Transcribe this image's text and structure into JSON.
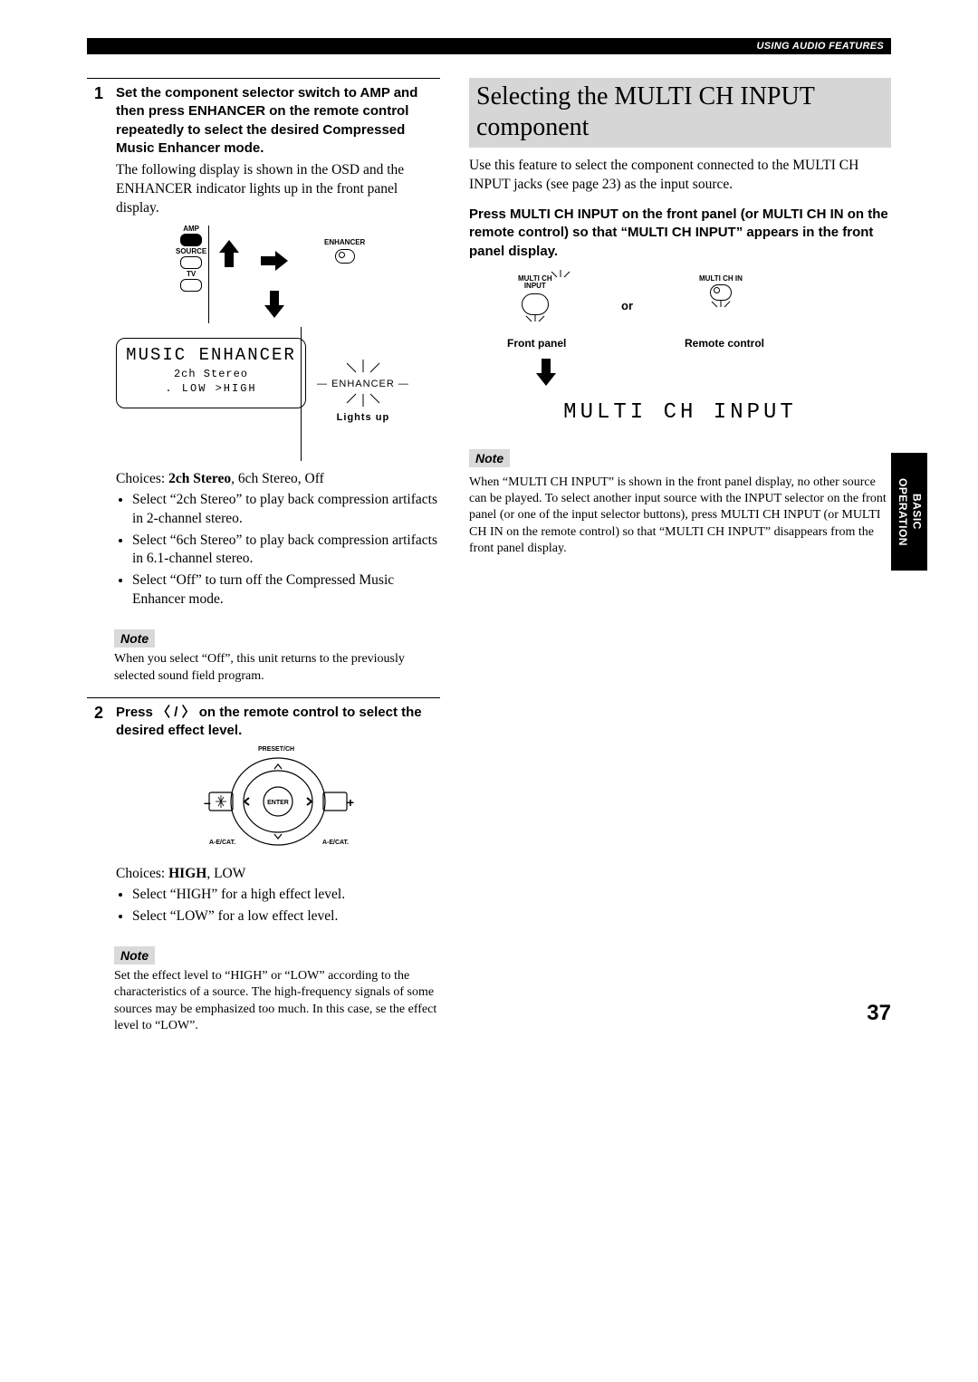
{
  "header": {
    "section": "USING AUDIO FEATURES"
  },
  "sideTab": "BASIC\nOPERATION",
  "pageNumber": "37",
  "left": {
    "step1": {
      "num": "1",
      "heading": "Set the component selector switch to AMP and then press ENHANCER on the remote control repeatedly to select the desired Compressed Music Enhancer mode.",
      "body": "The following display is shown in the OSD and the ENHANCER indicator lights up in the front panel display.",
      "ampLabels": {
        "amp": "AMP",
        "source": "SOURCE",
        "tv": "TV"
      },
      "enhancerLabel": "ENHANCER",
      "osd": {
        "line1": "MUSIC ENHANCER",
        "line2": "2ch Stereo",
        "line3": ".   LOW   >HIGH"
      },
      "ledLabel": "ENHANCER",
      "lightsUp": "Lights up",
      "choicesPrefix": "Choices: ",
      "choicesBold": "2ch Stereo",
      "choicesRest": ", 6ch Stereo, Off",
      "bullets": [
        "Select “2ch Stereo” to play back compression artifacts in 2-channel stereo.",
        "Select “6ch Stereo” to play back compression artifacts in 6.1-channel stereo.",
        "Select “Off” to turn off the Compressed Music Enhancer mode."
      ],
      "noteLabel": "Note",
      "noteText": "When you select “Off”, this unit returns to the previously selected sound field program."
    },
    "step2": {
      "num": "2",
      "headingPre": "Press ",
      "headingPost": " on the remote control to select the desired effect level.",
      "dpad": {
        "top": "PRESET/CH",
        "enter": "ENTER",
        "leftLab": "A-E/CAT.",
        "rightLab": "A-E/CAT.",
        "minus": "–",
        "plus": "+"
      },
      "choicesPrefix": "Choices: ",
      "choicesBold": "HIGH",
      "choicesRest": ", LOW",
      "bullets": [
        "Select “HIGH” for a high effect level.",
        "Select “LOW” for a low effect level."
      ],
      "noteLabel": "Note",
      "noteText": "Set the effect level to “HIGH” or “LOW” according to the characteristics of a source. The high-frequency signals of some sources may be emphasized too much. In this case, se the effect level to “LOW”."
    }
  },
  "right": {
    "title": "Selecting the MULTI CH INPUT component",
    "intro": "Use this feature to select the component connected to the MULTI CH INPUT jacks (see page 23) as the input source.",
    "instruction": "Press MULTI CH INPUT on the front panel (or MULTI CH IN on the remote control) so that “MULTI CH INPUT” appears in the front panel display.",
    "btnLeftLabel": "MULTI CH\nINPUT",
    "btnRightLabel": "MULTI CH IN",
    "or": "or",
    "frontPanel": "Front panel",
    "remoteControl": "Remote control",
    "dispText": "MULTI CH INPUT",
    "noteLabel": "Note",
    "noteText": "When “MULTI CH INPUT” is shown in the front panel display, no other source can be played. To select another input source with the INPUT selector on the front panel (or one of the input selector buttons), press MULTI CH INPUT (or MULTI CH IN on the remote control) so that “MULTI CH INPUT” disappears from the front panel display."
  }
}
